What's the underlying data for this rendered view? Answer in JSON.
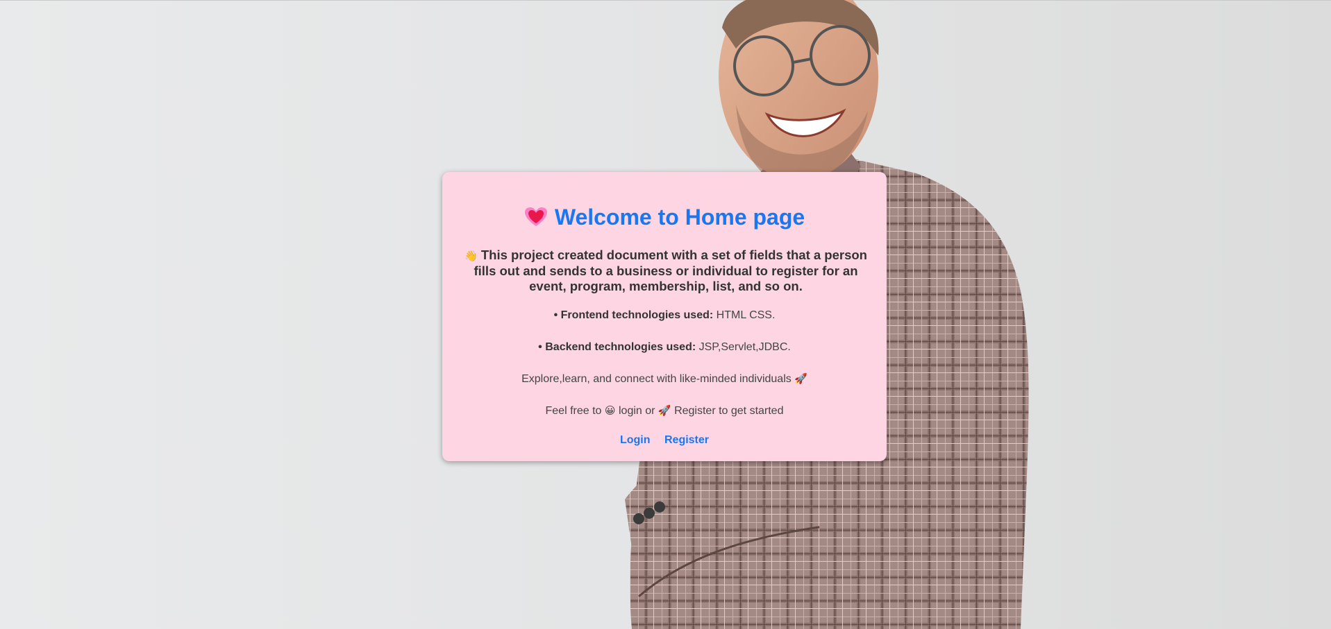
{
  "card": {
    "title_icon": "sparkling-heart-icon",
    "title": "Welcome to Home page",
    "intro_icon": "waving-hand-icon",
    "intro_emoji": "👋",
    "intro_text": "This project created document with a set of fields that a person fills out and sends to a business or individual to register for an event, program, membership, list, and so on.",
    "bullet": "•",
    "frontend_label": "Frontend technologies used:",
    "frontend_value": "HTML CSS.",
    "backend_label": "Backend technologies used:",
    "backend_value": "JSP,Servlet,JDBC.",
    "explore_text": "Explore,learn, and connect with like-minded individuals",
    "explore_icon": "rocket-icon",
    "explore_emoji": "🚀",
    "feel_prefix": "Feel free to",
    "feel_icon_1": "grinning-face-icon",
    "feel_emoji_1": "😀",
    "feel_middle": "login or",
    "feel_icon_2": "rocket-icon",
    "feel_emoji_2": "🚀",
    "feel_suffix": "Register to get started",
    "login_label": "Login",
    "register_label": "Register"
  },
  "colors": {
    "card_background": "#fdd5e3",
    "title": "#1877f2",
    "link": "#1877f2",
    "text": "#333333"
  }
}
